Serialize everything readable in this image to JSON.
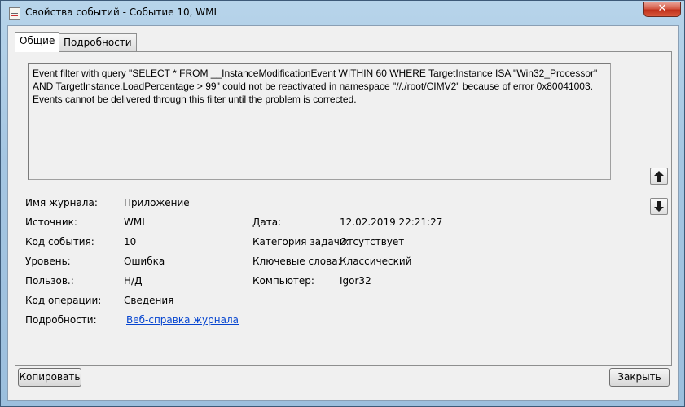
{
  "window": {
    "title": "Свойства событий - Событие 10, WMI",
    "close_label": "✕"
  },
  "tabs": [
    {
      "label": "Общие",
      "active": true
    },
    {
      "label": "Подробности",
      "active": false
    }
  ],
  "description": "Event filter with query \"SELECT * FROM __InstanceModificationEvent WITHIN 60 WHERE TargetInstance ISA \"Win32_Processor\" AND TargetInstance.LoadPercentage > 99\" could not be reactivated in namespace \"//./root/CIMV2\" because of error 0x80041003. Events cannot be delivered through this filter until the problem is corrected.",
  "fields": {
    "log_name": {
      "label": "Имя журнала:",
      "value": "Приложение"
    },
    "source": {
      "label": "Источник:",
      "value": "WMI"
    },
    "date": {
      "label": "Дата:",
      "value": "12.02.2019 22:21:27"
    },
    "event_id": {
      "label": "Код события:",
      "value": "10"
    },
    "task_category": {
      "label": "Категория задачи:",
      "value": "Отсутствует"
    },
    "level": {
      "label": "Уровень:",
      "value": "Ошибка"
    },
    "keywords": {
      "label": "Ключевые слова:",
      "value": "Классический"
    },
    "user": {
      "label": "Пользов.:",
      "value": "Н/Д"
    },
    "computer": {
      "label": "Компьютер:",
      "value": "Igor32"
    },
    "opcode": {
      "label": "Код операции:",
      "value": "Сведения"
    },
    "more_info": {
      "label": "Подробности:",
      "value": "Веб-справка журнала"
    }
  },
  "buttons": {
    "copy": "Копировать",
    "close": "Закрыть"
  },
  "icons": {
    "up": "arrow-up-icon",
    "down": "arrow-down-icon"
  }
}
